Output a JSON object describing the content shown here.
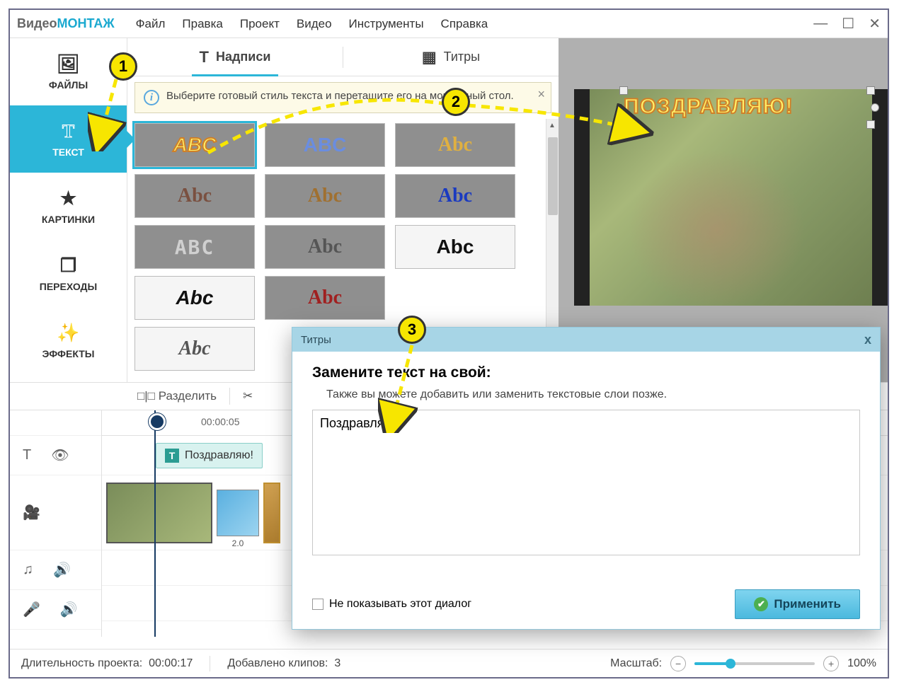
{
  "app": {
    "logo1": "Видео",
    "logo2": "МОНТАЖ"
  },
  "menu": [
    "Файл",
    "Правка",
    "Проект",
    "Видео",
    "Инструменты",
    "Справка"
  ],
  "sidebar": {
    "items": [
      {
        "label": "ФАЙЛЫ"
      },
      {
        "label": "ТЕКСТ"
      },
      {
        "label": "КАРТИНКИ"
      },
      {
        "label": "ПЕРЕХОДЫ"
      },
      {
        "label": "ЭФФЕКТЫ"
      }
    ]
  },
  "tabs": {
    "captions": "Надписи",
    "titles": "Титры"
  },
  "info_banner": "Выберите готовый стиль текста и перетащите его на монтажный стол.",
  "preview": {
    "overlay_text": "ПОЗДРАВЛЯЮ!"
  },
  "toolbar": {
    "split": "Разделить"
  },
  "timeline": {
    "time_label": "00:00:05",
    "text_clip": "Поздравляю!",
    "transition_duration": "2.0"
  },
  "dialog": {
    "title": "Титры",
    "heading": "Замените текст на свой:",
    "subheading": "Также вы можете добавить или заменить текстовые слои позже.",
    "text_value": "Поздравляю!",
    "dont_show": "Не показывать этот диалог",
    "apply": "Применить"
  },
  "status": {
    "duration_label": "Длительность проекта:",
    "duration_value": "00:00:17",
    "clips_label": "Добавлено клипов:",
    "clips_value": "3",
    "zoom_label": "Масштаб:",
    "zoom_value": "100%"
  },
  "style_samples": [
    [
      "ABC",
      "ABC",
      "Abc"
    ],
    [
      "Abc",
      "Abc",
      "Abc"
    ],
    [
      "ABC",
      "Abc",
      "Abc"
    ],
    [
      "Abc",
      "Abc",
      ""
    ],
    [
      "Abc",
      "",
      ""
    ]
  ],
  "annotations": {
    "b1": "1",
    "b2": "2",
    "b3": "3"
  }
}
